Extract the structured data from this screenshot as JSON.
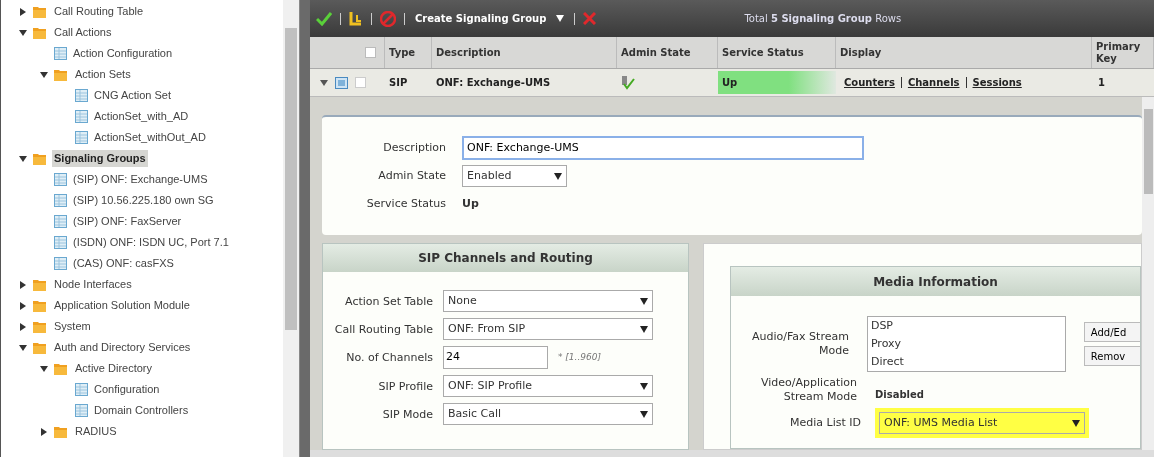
{
  "tree": [
    {
      "label": "Call Routing Table",
      "kind": "folder",
      "expanded": false,
      "selected": false
    },
    {
      "label": "Call Actions",
      "kind": "folder",
      "expanded": true,
      "selected": false,
      "children": [
        {
          "label": "Action Configuration",
          "kind": "table",
          "selected": false
        },
        {
          "label": "Action Sets",
          "kind": "folder",
          "expanded": true,
          "selected": false,
          "children": [
            {
              "label": "CNG Action Set",
              "kind": "table",
              "selected": false
            },
            {
              "label": "ActionSet_with_AD",
              "kind": "table",
              "selected": false
            },
            {
              "label": "ActionSet_withOut_AD",
              "kind": "table",
              "selected": false
            }
          ]
        }
      ]
    },
    {
      "label": "Signaling Groups",
      "kind": "folder",
      "expanded": true,
      "selected": true,
      "children": [
        {
          "label": "(SIP) ONF: Exchange-UMS",
          "kind": "table",
          "selected": false
        },
        {
          "label": "(SIP) 10.56.225.180 own SG",
          "kind": "table",
          "selected": false
        },
        {
          "label": "(SIP) ONF: FaxServer",
          "kind": "table",
          "selected": false
        },
        {
          "label": "(ISDN) ONF: ISDN UC, Port 7.1",
          "kind": "table",
          "selected": false
        },
        {
          "label": "(CAS) ONF: casFXS",
          "kind": "table",
          "selected": false
        }
      ]
    },
    {
      "label": "Node Interfaces",
      "kind": "folder",
      "expanded": false,
      "selected": false
    },
    {
      "label": "Application Solution Module",
      "kind": "folder",
      "expanded": false,
      "selected": false
    },
    {
      "label": "System",
      "kind": "folder",
      "expanded": false,
      "selected": false
    },
    {
      "label": "Auth and Directory Services",
      "kind": "folder",
      "expanded": true,
      "selected": false,
      "children": [
        {
          "label": "Active Directory",
          "kind": "folder",
          "expanded": true,
          "selected": false,
          "children": [
            {
              "label": "Configuration",
              "kind": "table",
              "selected": false
            },
            {
              "label": "Domain Controllers",
              "kind": "table",
              "selected": false
            }
          ]
        },
        {
          "label": "RADIUS",
          "kind": "folder",
          "expanded": false,
          "selected": false
        }
      ]
    }
  ],
  "toolbar": {
    "buttons": [
      {
        "kind": "apply"
      },
      {
        "kind": "export"
      },
      {
        "kind": "cancel"
      }
    ],
    "create_label": "Create Signaling Group",
    "delete": {
      "kind": "delete"
    },
    "total": "Total **5 Signaling Group** Rows"
  },
  "table": {
    "columns": [
      "Type",
      "Description",
      "Admin State",
      "Service Status",
      "Display",
      "Primary Key"
    ],
    "header_checked": false,
    "rows": [
      {
        "expanded": true,
        "checked": false,
        "type": "SIP",
        "description": "ONF: Exchange-UMS",
        "admin_enabled": true,
        "service_status": "Up",
        "service_up": true,
        "links": [
          "Counters",
          "Channels",
          "Sessions"
        ],
        "primary_key": "1"
      }
    ]
  },
  "general": {
    "fields": [
      {
        "kind": "input",
        "label": "Description",
        "value": "ONF: Exchange-UMS",
        "focused": true
      },
      {
        "kind": "select",
        "label": "Admin State",
        "value": "Enabled"
      },
      {
        "kind": "text",
        "label": "Service Status",
        "value": "Up"
      }
    ]
  },
  "sip_panel": {
    "title": "SIP Channels and Routing",
    "fields": [
      {
        "kind": "select",
        "label": "Action Set Table",
        "value": "None"
      },
      {
        "kind": "select",
        "label": "Call Routing Table",
        "value": "ONF: From SIP"
      },
      {
        "kind": "input",
        "label": "No. of Channels",
        "value": "24",
        "note": "* [1..960]"
      },
      {
        "kind": "select",
        "label": "SIP Profile",
        "value": "ONF: SIP Profile"
      },
      {
        "kind": "select",
        "label": "SIP Mode",
        "value": "Basic Call"
      }
    ]
  },
  "media_panel": {
    "title": "Media Information",
    "audio_label": "Audio/Fax Stream Mode",
    "audio_options": [
      "DSP",
      "Proxy",
      "Direct"
    ],
    "buttons": [
      "Add/Ed",
      "Remov"
    ],
    "video_label": "Video/Application Stream Mode",
    "video_value": "Disabled",
    "media_list_label": "Media List ID",
    "media_list_value": "ONF: UMS Media List",
    "media_list_highlighted": true
  }
}
